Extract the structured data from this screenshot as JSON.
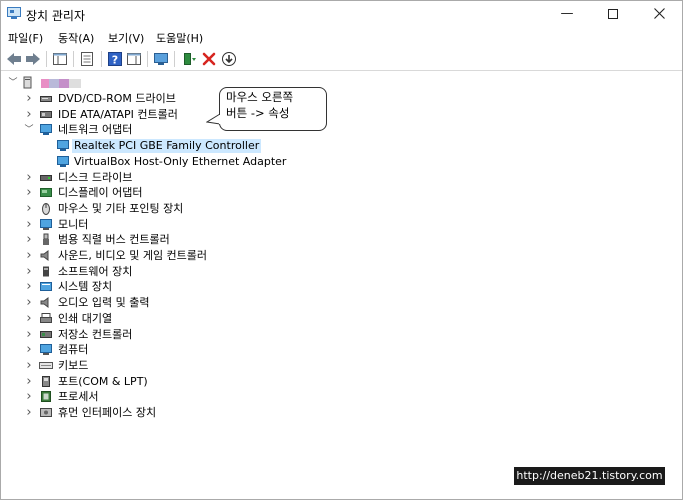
{
  "window": {
    "title": "장치 관리자"
  },
  "menu": {
    "file": "파일(F)",
    "action": "동작(A)",
    "view": "보기(V)",
    "help": "도움말(H)"
  },
  "tree": {
    "items": [
      {
        "label": "DVD/CD-ROM 드라이브",
        "icon": "dvd-drive-icon"
      },
      {
        "label": "IDE ATA/ATAPI 컨트롤러",
        "icon": "ide-controller-icon"
      },
      {
        "label": "네트워크 어댑터",
        "icon": "network-adapter-icon"
      },
      {
        "label": "Realtek PCI GBE Family Controller",
        "icon": "network-adapter-icon"
      },
      {
        "label": "VirtualBox Host-Only Ethernet Adapter",
        "icon": "network-adapter-icon"
      },
      {
        "label": "디스크 드라이브",
        "icon": "disk-drive-icon"
      },
      {
        "label": "디스플레이 어댑터",
        "icon": "display-adapter-icon"
      },
      {
        "label": "마우스 및 기타 포인팅 장치",
        "icon": "mouse-icon"
      },
      {
        "label": "모니터",
        "icon": "monitor-icon"
      },
      {
        "label": "범용 직렬 버스 컨트롤러",
        "icon": "usb-icon"
      },
      {
        "label": "사운드, 비디오 및 게임 컨트롤러",
        "icon": "sound-icon"
      },
      {
        "label": "소프트웨어 장치",
        "icon": "software-device-icon"
      },
      {
        "label": "시스템 장치",
        "icon": "system-device-icon"
      },
      {
        "label": "오디오 입력 및 출력",
        "icon": "audio-icon"
      },
      {
        "label": "인쇄 대기열",
        "icon": "printer-icon"
      },
      {
        "label": "저장소 컨트롤러",
        "icon": "storage-controller-icon"
      },
      {
        "label": "컴퓨터",
        "icon": "computer-icon"
      },
      {
        "label": "키보드",
        "icon": "keyboard-icon"
      },
      {
        "label": "포트(COM & LPT)",
        "icon": "port-icon"
      },
      {
        "label": "프로세서",
        "icon": "processor-icon"
      },
      {
        "label": "휴먼 인터페이스 장치",
        "icon": "hid-icon"
      }
    ]
  },
  "callout": {
    "line1": "마우스 오른쪽",
    "line2": "버튼 -> 속성"
  },
  "watermark": "http://deneb21.tistory.com"
}
